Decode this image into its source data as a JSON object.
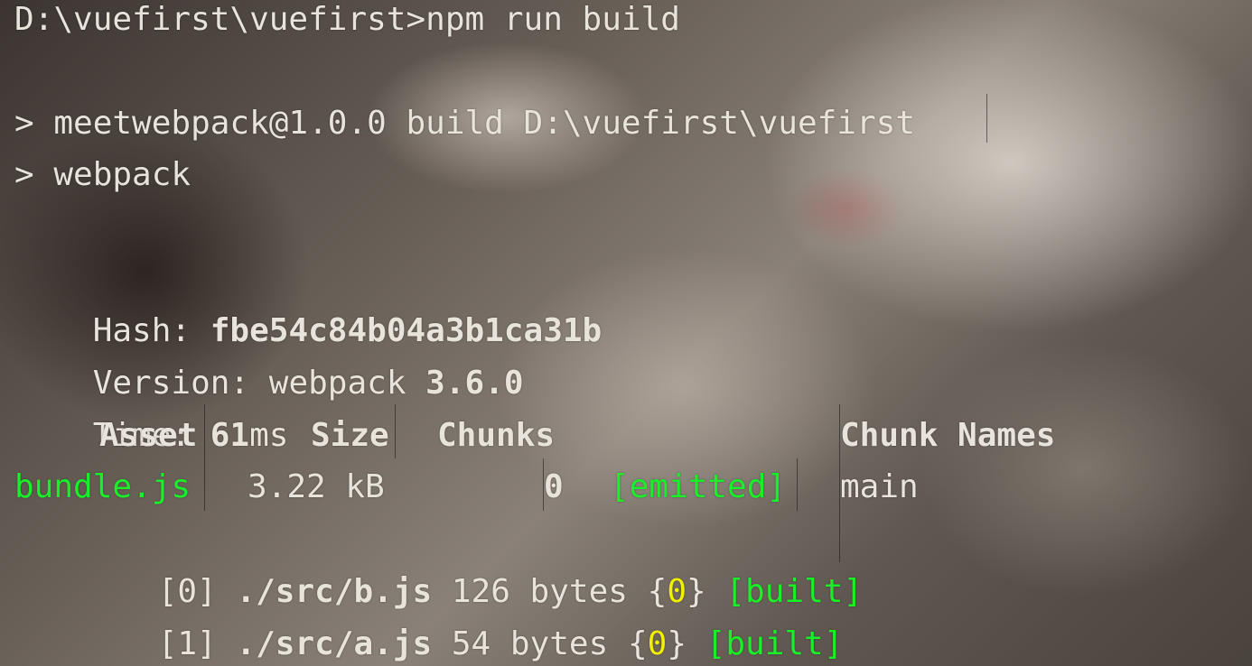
{
  "terminal": {
    "command_line": "D:\\vuefirst\\vuefirst>npm run build",
    "script_line_1": "> meetwebpack@1.0.0 build D:\\vuefirst\\vuefirst",
    "script_line_2": "> webpack",
    "hash_label": "Hash: ",
    "hash_value": "fbe54c84b04a3b1ca31b",
    "version_label": "Version: ",
    "version_name": "webpack ",
    "version_value": "3.6.0",
    "time_label": "Time: ",
    "time_value": "61",
    "time_unit": "ms"
  },
  "asset_table": {
    "headers": {
      "asset": "Asset",
      "size": "Size",
      "chunks": "Chunks",
      "chunk_names": "Chunk Names"
    },
    "rows": [
      {
        "asset": "bundle.js",
        "size": "3.22 kB",
        "chunks": "0",
        "status": "[emitted]",
        "chunk_name": "main"
      }
    ]
  },
  "modules": [
    {
      "id": "[0]",
      "path": "./src/b.js",
      "size": "126 bytes",
      "brace_open": "{",
      "chunk": "0",
      "brace_close": "}",
      "status": "[built]"
    },
    {
      "id": "[1]",
      "path": "./src/a.js",
      "size": "54 bytes",
      "brace_open": "{",
      "chunk": "0",
      "brace_close": "}",
      "status": "[built]"
    }
  ],
  "colors": {
    "text": "#e8e4dc",
    "green": "#1aef2a",
    "yellow": "#f0f000"
  }
}
